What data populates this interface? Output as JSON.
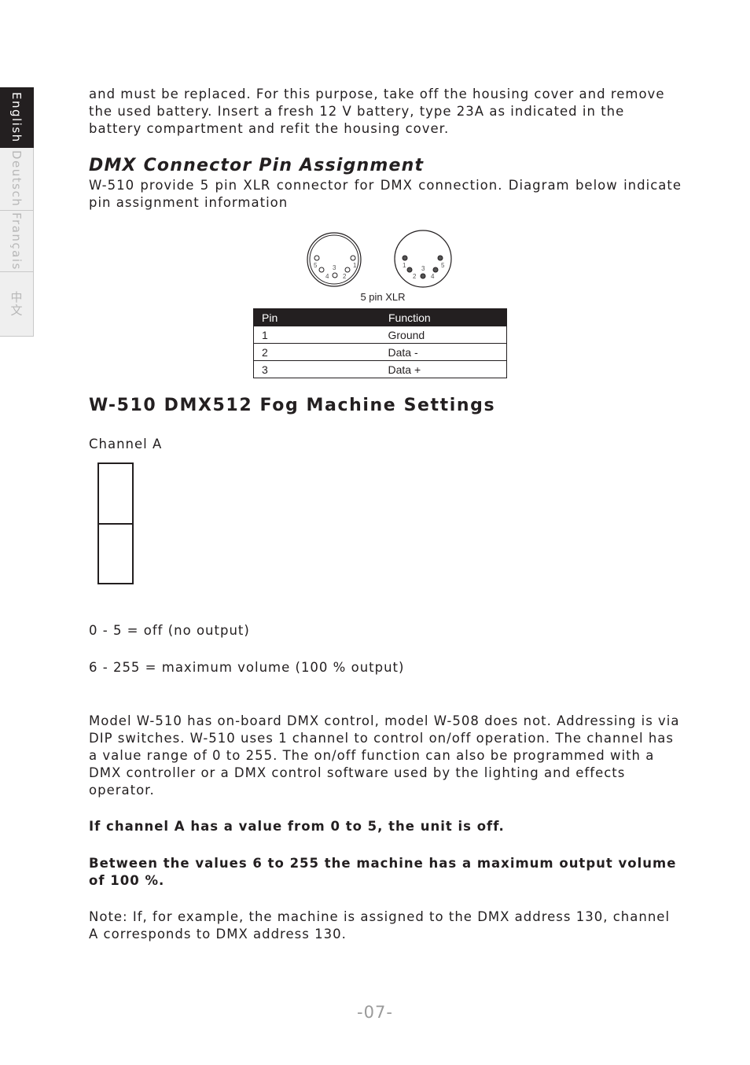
{
  "language_tabs": [
    {
      "label": "English",
      "active": true
    },
    {
      "label": "Deutsch",
      "active": false
    },
    {
      "label": "Français",
      "active": false
    },
    {
      "label": "中文",
      "active": false
    }
  ],
  "intro_paragraph": "and must be replaced. For this purpose, take off the housing cover and remove the used battery. Insert a fresh 12 V battery, type 23A as indicated in the battery compartment and refit the housing cover.",
  "dmx_section": {
    "heading": "DMX Connector Pin Assignment",
    "description": "W-510 provide 5 pin XLR connector for DMX connection. Diagram below indicate pin assignment information",
    "diagram_label": "5 pin XLR",
    "female_pin_labels": [
      "1",
      "2",
      "3",
      "4",
      "5"
    ],
    "male_pin_labels": [
      "1",
      "2",
      "3",
      "4",
      "5"
    ],
    "table": {
      "headers": [
        "Pin",
        "Function"
      ],
      "rows": [
        [
          "1",
          "Ground"
        ],
        [
          "2",
          "Data -"
        ],
        [
          "3",
          "Data +"
        ]
      ]
    }
  },
  "settings_section": {
    "heading": "W-510 DMX512 Fog Machine Settings",
    "channel_label": "Channel A",
    "value_off": "0 - 5 = off (no output)",
    "value_max": "6 - 255 = maximum volume (100 % output)",
    "model_paragraph": "Model W-510 has on-board DMX control, model W-508 does not. Addressing is via DIP switches. W-510 uses 1 channel to control on/off operation. The channel has a value range of 0 to 255. The on/off function can also be programmed with a DMX controller or a DMX control software used by the lighting and effects operator.",
    "bold_note_1": "If channel A has a value from 0 to 5, the unit is off.",
    "bold_note_2": "Between the values 6 to 255 the machine has a maximum output volume of 100 %.",
    "note": "Note: If, for example, the machine is assigned to the DMX address 130, channel A corresponds to DMX address 130."
  },
  "page_number": "-07-"
}
